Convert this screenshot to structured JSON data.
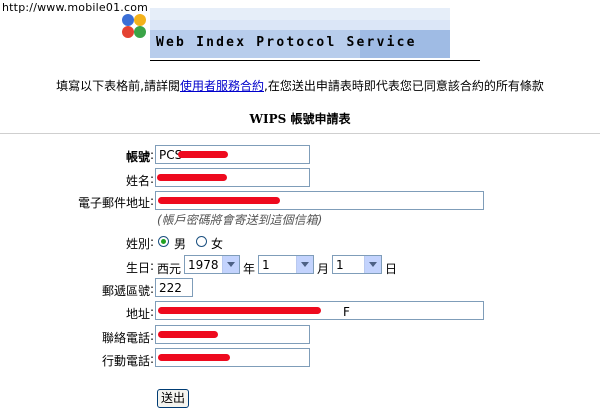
{
  "watermark": "http://www.mobile01.com",
  "header": {
    "title": "Web Index Protocol Service"
  },
  "notice": {
    "before": "填寫以下表格前,請詳閱",
    "link": "使用者服務合約",
    "after": ",在您送出申請表時即代表您已同意該合約的所有條款"
  },
  "form": {
    "title": "WIPS 帳號申請表",
    "account": {
      "label": "帳號",
      "value": "PCS"
    },
    "name": {
      "label": "姓名",
      "value": ""
    },
    "email": {
      "label": "電子郵件地址",
      "value": "",
      "hint": "(帳戶密碼將會寄送到這個信箱)"
    },
    "gender": {
      "label": "姓別",
      "options": [
        "男",
        "女"
      ],
      "selected": "男"
    },
    "birthday": {
      "label": "生日",
      "era": "西元",
      "year": "1978",
      "year_unit": "年",
      "month": "1",
      "month_unit": "月",
      "day": "1",
      "day_unit": "日"
    },
    "zip": {
      "label": "郵遞區號",
      "value": "222"
    },
    "address": {
      "label": "地址",
      "value": "",
      "tail": "F"
    },
    "phone": {
      "label": "聯絡電話",
      "value": ""
    },
    "mobile": {
      "label": "行動電話",
      "value": ""
    },
    "submit": "送出"
  },
  "colors": {
    "redaction": "#ee0a1e",
    "link": "#0000cc",
    "radio_dot": "#21a121"
  }
}
